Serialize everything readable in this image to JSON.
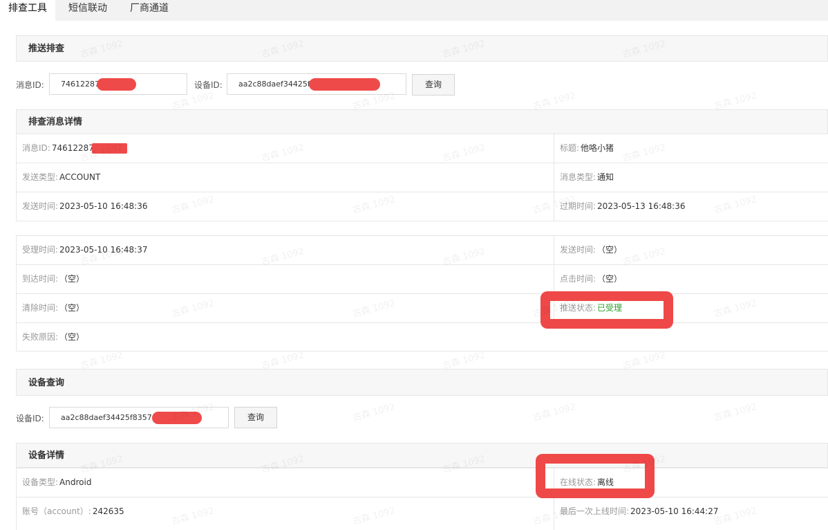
{
  "tabs": [
    "排查工具",
    "短信联动",
    "厂商通道"
  ],
  "push_check": {
    "title": "推送排查",
    "msg_id_label": "消息ID:",
    "msg_id_value": "74612287",
    "device_id_label": "设备ID:",
    "device_id_value": "aa2c88daef34425f8",
    "query_label": "查询"
  },
  "message_detail": {
    "title": "排查消息详情",
    "rows": [
      {
        "lk": "消息ID:",
        "lv": "74612287",
        "rk": "标题:",
        "rv": "他咯小猪"
      },
      {
        "lk": "发送类型:",
        "lv": "ACCOUNT",
        "rk": "消息类型:",
        "rv": "通知"
      },
      {
        "lk": "发送时间:",
        "lv": "2023-05-10 16:48:36",
        "rk": "过期时间:",
        "rv": "2023-05-13 16:48:36"
      }
    ]
  },
  "status_detail": {
    "rows": [
      {
        "lk": "受理时间:",
        "lv": "2023-05-10 16:48:37",
        "rk": "发送时间:",
        "rv": "（空）"
      },
      {
        "lk": "到达时间:",
        "lv": "（空）",
        "rk": "点击时间:",
        "rv": "（空）"
      },
      {
        "lk": "清除时间:",
        "lv": "（空）",
        "rk": "推送状态:",
        "rv": "已受理"
      },
      {
        "lk": "失败原因:",
        "lv": "（空）"
      }
    ],
    "status_color": "#2b9e2b"
  },
  "device_query": {
    "title": "设备查询",
    "device_id_label": "设备ID:",
    "device_id_value": "aa2c88daef34425f835707",
    "query_label": "查询"
  },
  "device_detail": {
    "title": "设备详情",
    "rows": [
      {
        "lk": "设备类型:",
        "lv": "Android",
        "rk": "在线状态:",
        "rv": "离线"
      },
      {
        "lk": "账号（account）:",
        "lv": "242635",
        "rk": "最后一次上线时间:",
        "rv": "2023-05-10 16:44:27"
      }
    ]
  },
  "watermark": "古森 1092",
  "highlight_color": "#ef4848"
}
